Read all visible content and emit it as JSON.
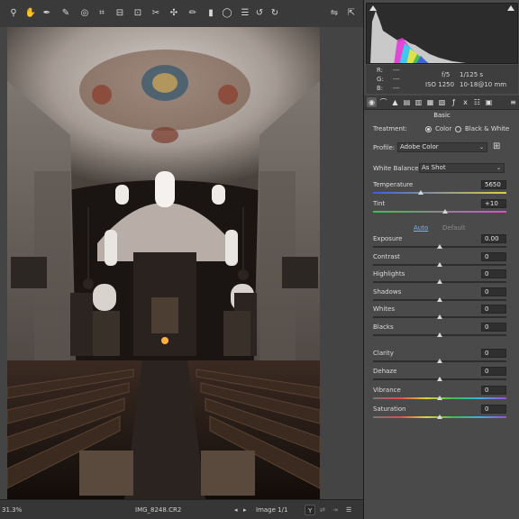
{
  "toolbar": {
    "tools": [
      {
        "icon": "zoom-tool-icon",
        "glyph": "⚲"
      },
      {
        "icon": "hand-tool-icon",
        "glyph": "✋"
      },
      {
        "icon": "white-balance-tool-icon",
        "glyph": "✒"
      },
      {
        "icon": "color-sampler-tool-icon",
        "glyph": "✎"
      },
      {
        "icon": "targeted-adjustment-tool-icon",
        "glyph": "◎"
      },
      {
        "icon": "crop-tool-icon",
        "glyph": "⌗"
      },
      {
        "icon": "straighten-tool-icon",
        "glyph": "⊟"
      },
      {
        "icon": "transform-tool-icon",
        "glyph": "⊡"
      },
      {
        "icon": "spot-removal-tool-icon",
        "glyph": "✂"
      },
      {
        "icon": "red-eye-tool-icon",
        "glyph": "✣"
      },
      {
        "icon": "adjustment-brush-icon",
        "glyph": "✏"
      },
      {
        "icon": "graduated-filter-icon",
        "glyph": "▮"
      },
      {
        "icon": "radial-filter-icon",
        "glyph": "◯"
      },
      {
        "icon": "preferences-icon",
        "glyph": "☰"
      },
      {
        "icon": "rotate-left-icon",
        "glyph": "↺"
      },
      {
        "icon": "rotate-right-icon",
        "glyph": "↻"
      }
    ],
    "right_tools": [
      {
        "icon": "toggle-markers-icon",
        "glyph": "⇋"
      },
      {
        "icon": "full-screen-icon",
        "glyph": "⇱"
      }
    ]
  },
  "status": {
    "zoom": "31.3%",
    "filename": "IMG_8248.CR2",
    "image_counter": "Image 1/1",
    "view_mode_label": "Y"
  },
  "readout": {
    "r_label": "R:",
    "r_value": "---",
    "g_label": "G:",
    "g_value": "---",
    "b_label": "B:",
    "b_value": "---",
    "aperture": "f/5",
    "shutter": "1/125 s",
    "iso": "ISO 1250",
    "lens": "10-18@10 mm"
  },
  "panel": {
    "section_title": "Basic",
    "treatment_label": "Treatment:",
    "treatment_options": [
      "Color",
      "Black & White"
    ],
    "treatment_selected": "Color",
    "profile_label": "Profile:",
    "profile_value": "Adobe Color",
    "white_balance_label": "White Balance:",
    "white_balance_value": "As Shot",
    "auto_label": "Auto",
    "default_label": "Default",
    "sliders": [
      {
        "label": "Temperature",
        "value": "5650",
        "position": 0.36
      },
      {
        "label": "Tint",
        "value": "+10",
        "position": 0.54
      },
      {
        "label": "Exposure",
        "value": "0.00",
        "position": 0.5
      },
      {
        "label": "Contrast",
        "value": "0",
        "position": 0.5
      },
      {
        "label": "Highlights",
        "value": "0",
        "position": 0.5
      },
      {
        "label": "Shadows",
        "value": "0",
        "position": 0.5
      },
      {
        "label": "Whites",
        "value": "0",
        "position": 0.5
      },
      {
        "label": "Blacks",
        "value": "0",
        "position": 0.5
      },
      {
        "label": "Clarity",
        "value": "0",
        "position": 0.5
      },
      {
        "label": "Dehaze",
        "value": "0",
        "position": 0.5
      },
      {
        "label": "Vibrance",
        "value": "0",
        "position": 0.5
      },
      {
        "label": "Saturation",
        "value": "0",
        "position": 0.5
      }
    ]
  },
  "colors": {
    "accent_link": "#7fb0e8",
    "disabled_text": "#8a8a8a"
  }
}
